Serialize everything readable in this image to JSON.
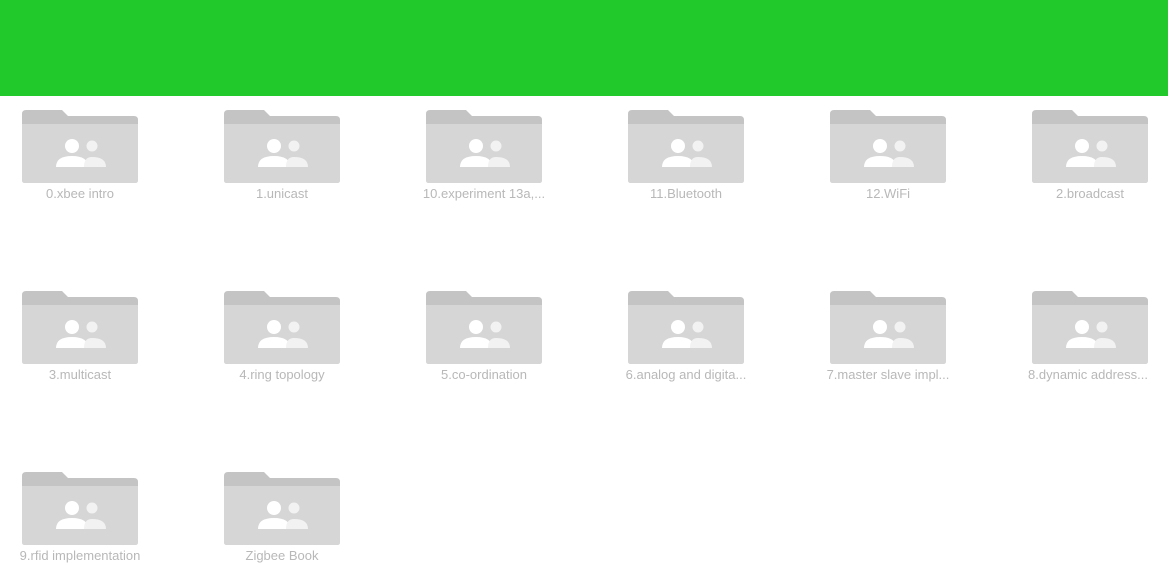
{
  "header": {
    "color": "#22c92a"
  },
  "folders": [
    {
      "label": "0.xbee intro",
      "icon": "shared-folder-icon"
    },
    {
      "label": "1.unicast",
      "icon": "shared-folder-icon"
    },
    {
      "label": "10.experiment 13a,...",
      "icon": "shared-folder-icon"
    },
    {
      "label": "11.Bluetooth",
      "icon": "shared-folder-icon"
    },
    {
      "label": "12.WiFi",
      "icon": "shared-folder-icon"
    },
    {
      "label": "2.broadcast",
      "icon": "shared-folder-icon"
    },
    {
      "label": "3.multicast",
      "icon": "shared-folder-icon"
    },
    {
      "label": "4.ring topology",
      "icon": "shared-folder-icon"
    },
    {
      "label": "5.co-ordination",
      "icon": "shared-folder-icon"
    },
    {
      "label": "6.analog and digita...",
      "icon": "shared-folder-icon"
    },
    {
      "label": "7.master slave impl...",
      "icon": "shared-folder-icon"
    },
    {
      "label": "8.dynamic address...",
      "icon": "shared-folder-icon"
    },
    {
      "label": "9.rfid implementation",
      "icon": "shared-folder-icon"
    },
    {
      "label": "Zigbee Book",
      "icon": "shared-folder-icon"
    }
  ],
  "colors": {
    "folder_back": "#c4c4c4",
    "folder_front": "#d6d6d6",
    "people": "#ffffff",
    "label": "#b8b8b8"
  }
}
